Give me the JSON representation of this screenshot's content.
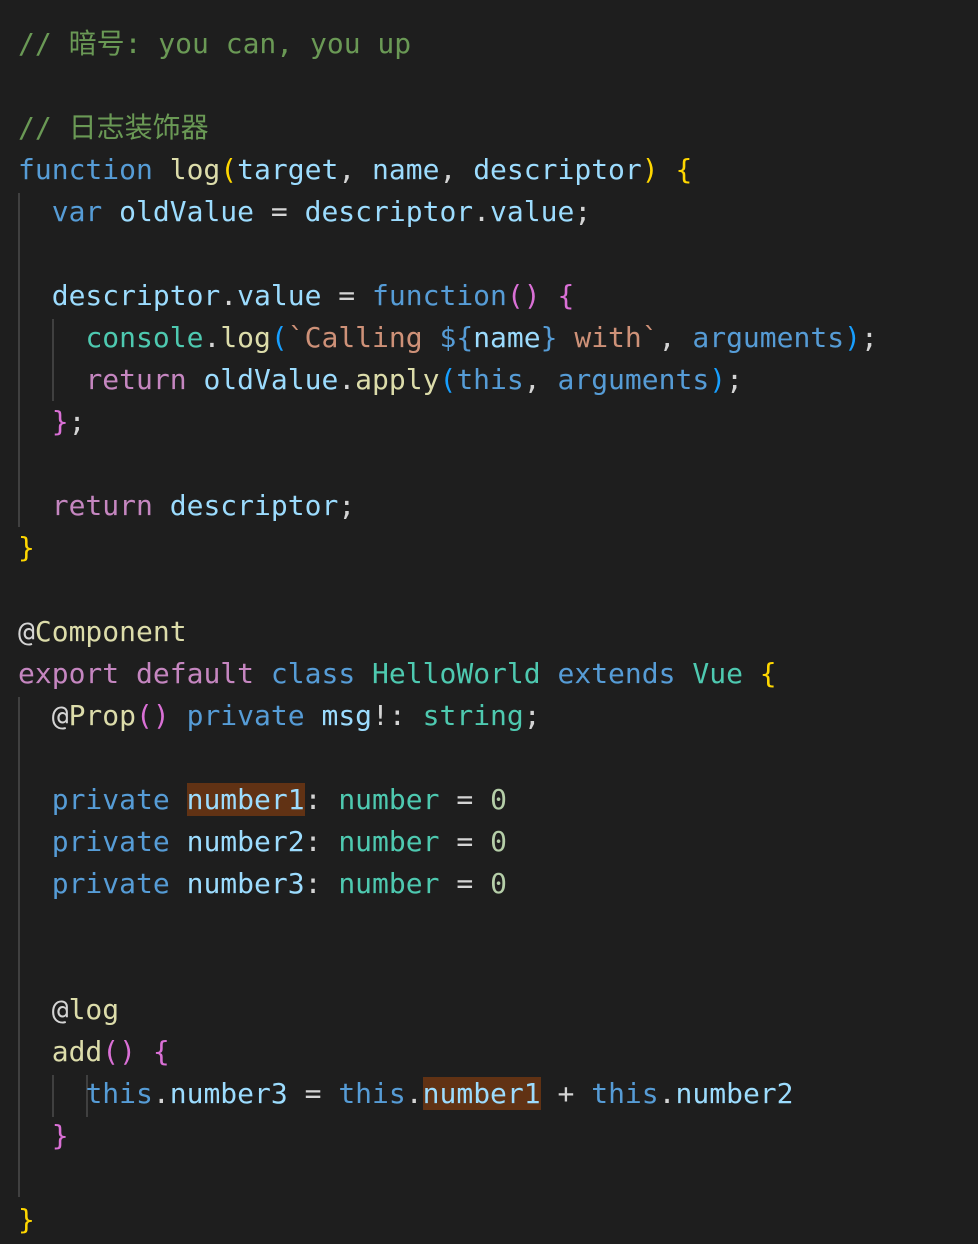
{
  "colors": {
    "background": "#1e1e1e",
    "comment": "#6a9955",
    "keyword_blue": "#569cd6",
    "keyword_purple": "#c586c0",
    "function": "#dcdcaa",
    "variable": "#9cdcfe",
    "type": "#4ec9b0",
    "string": "#ce9178",
    "number": "#b5cea8",
    "plain": "#d4d4d4",
    "bracket_gold": "#ffd700",
    "bracket_pink": "#da70d6",
    "bracket_blue": "#179fff",
    "highlight_bg": "#613214",
    "indent_guide": "#404040"
  },
  "code_lines": [
    [
      {
        "t": "// 暗号: you can, you up",
        "c": "comment"
      }
    ],
    [],
    [
      {
        "t": "// 日志装饰器",
        "c": "comment"
      }
    ],
    [
      {
        "t": "function",
        "c": "keyword_blue"
      },
      {
        "t": " ",
        "c": "plain"
      },
      {
        "t": "log",
        "c": "function"
      },
      {
        "t": "(",
        "c": "bracket_gold"
      },
      {
        "t": "target",
        "c": "variable"
      },
      {
        "t": ", ",
        "c": "plain"
      },
      {
        "t": "name",
        "c": "variable"
      },
      {
        "t": ", ",
        "c": "plain"
      },
      {
        "t": "descriptor",
        "c": "variable"
      },
      {
        "t": ")",
        "c": "bracket_gold"
      },
      {
        "t": " ",
        "c": "plain"
      },
      {
        "t": "{",
        "c": "bracket_gold"
      }
    ],
    [
      {
        "t": "  ",
        "c": "plain"
      },
      {
        "t": "var",
        "c": "keyword_blue"
      },
      {
        "t": " ",
        "c": "plain"
      },
      {
        "t": "oldValue",
        "c": "variable"
      },
      {
        "t": " = ",
        "c": "plain"
      },
      {
        "t": "descriptor",
        "c": "variable"
      },
      {
        "t": ".",
        "c": "plain"
      },
      {
        "t": "value",
        "c": "variable"
      },
      {
        "t": ";",
        "c": "plain"
      }
    ],
    [],
    [
      {
        "t": "  ",
        "c": "plain"
      },
      {
        "t": "descriptor",
        "c": "variable"
      },
      {
        "t": ".",
        "c": "plain"
      },
      {
        "t": "value",
        "c": "variable"
      },
      {
        "t": " = ",
        "c": "plain"
      },
      {
        "t": "function",
        "c": "keyword_blue"
      },
      {
        "t": "()",
        "c": "bracket_pink"
      },
      {
        "t": " ",
        "c": "plain"
      },
      {
        "t": "{",
        "c": "bracket_pink"
      }
    ],
    [
      {
        "t": "    ",
        "c": "plain"
      },
      {
        "t": "console",
        "c": "type"
      },
      {
        "t": ".",
        "c": "plain"
      },
      {
        "t": "log",
        "c": "function"
      },
      {
        "t": "(",
        "c": "bracket_blue"
      },
      {
        "t": "`Calling ",
        "c": "string"
      },
      {
        "t": "${",
        "c": "keyword_blue"
      },
      {
        "t": "name",
        "c": "variable"
      },
      {
        "t": "}",
        "c": "keyword_blue"
      },
      {
        "t": " with`",
        "c": "string"
      },
      {
        "t": ", ",
        "c": "plain"
      },
      {
        "t": "arguments",
        "c": "keyword_blue"
      },
      {
        "t": ")",
        "c": "bracket_blue"
      },
      {
        "t": ";",
        "c": "plain"
      }
    ],
    [
      {
        "t": "    ",
        "c": "plain"
      },
      {
        "t": "return",
        "c": "keyword_purple"
      },
      {
        "t": " ",
        "c": "plain"
      },
      {
        "t": "oldValue",
        "c": "variable"
      },
      {
        "t": ".",
        "c": "plain"
      },
      {
        "t": "apply",
        "c": "function"
      },
      {
        "t": "(",
        "c": "bracket_blue"
      },
      {
        "t": "this",
        "c": "keyword_blue"
      },
      {
        "t": ", ",
        "c": "plain"
      },
      {
        "t": "arguments",
        "c": "keyword_blue"
      },
      {
        "t": ")",
        "c": "bracket_blue"
      },
      {
        "t": ";",
        "c": "plain"
      }
    ],
    [
      {
        "t": "  ",
        "c": "plain"
      },
      {
        "t": "}",
        "c": "bracket_pink"
      },
      {
        "t": ";",
        "c": "plain"
      }
    ],
    [],
    [
      {
        "t": "  ",
        "c": "plain"
      },
      {
        "t": "return",
        "c": "keyword_purple"
      },
      {
        "t": " ",
        "c": "plain"
      },
      {
        "t": "descriptor",
        "c": "variable"
      },
      {
        "t": ";",
        "c": "plain"
      }
    ],
    [
      {
        "t": "}",
        "c": "bracket_gold"
      }
    ],
    [],
    [
      {
        "t": "@",
        "c": "plain"
      },
      {
        "t": "Component",
        "c": "function"
      }
    ],
    [
      {
        "t": "export",
        "c": "keyword_purple"
      },
      {
        "t": " ",
        "c": "plain"
      },
      {
        "t": "default",
        "c": "keyword_purple"
      },
      {
        "t": " ",
        "c": "plain"
      },
      {
        "t": "class",
        "c": "keyword_blue"
      },
      {
        "t": " ",
        "c": "plain"
      },
      {
        "t": "HelloWorld",
        "c": "type"
      },
      {
        "t": " ",
        "c": "plain"
      },
      {
        "t": "extends",
        "c": "keyword_blue"
      },
      {
        "t": " ",
        "c": "plain"
      },
      {
        "t": "Vue",
        "c": "type"
      },
      {
        "t": " ",
        "c": "plain"
      },
      {
        "t": "{",
        "c": "bracket_gold"
      }
    ],
    [
      {
        "t": "  ",
        "c": "plain"
      },
      {
        "t": "@",
        "c": "plain"
      },
      {
        "t": "Prop",
        "c": "function"
      },
      {
        "t": "()",
        "c": "bracket_pink"
      },
      {
        "t": " ",
        "c": "plain"
      },
      {
        "t": "private",
        "c": "keyword_blue"
      },
      {
        "t": " ",
        "c": "plain"
      },
      {
        "t": "msg",
        "c": "variable"
      },
      {
        "t": "!: ",
        "c": "plain"
      },
      {
        "t": "string",
        "c": "type"
      },
      {
        "t": ";",
        "c": "plain"
      }
    ],
    [],
    [
      {
        "t": "  ",
        "c": "plain"
      },
      {
        "t": "private",
        "c": "keyword_blue"
      },
      {
        "t": " ",
        "c": "plain"
      },
      {
        "t": "number1",
        "c": "variable",
        "hl": true
      },
      {
        "t": ": ",
        "c": "plain"
      },
      {
        "t": "number",
        "c": "type"
      },
      {
        "t": " = ",
        "c": "plain"
      },
      {
        "t": "0",
        "c": "number"
      }
    ],
    [
      {
        "t": "  ",
        "c": "plain"
      },
      {
        "t": "private",
        "c": "keyword_blue"
      },
      {
        "t": " ",
        "c": "plain"
      },
      {
        "t": "number2",
        "c": "variable"
      },
      {
        "t": ": ",
        "c": "plain"
      },
      {
        "t": "number",
        "c": "type"
      },
      {
        "t": " = ",
        "c": "plain"
      },
      {
        "t": "0",
        "c": "number"
      }
    ],
    [
      {
        "t": "  ",
        "c": "plain"
      },
      {
        "t": "private",
        "c": "keyword_blue"
      },
      {
        "t": " ",
        "c": "plain"
      },
      {
        "t": "number3",
        "c": "variable"
      },
      {
        "t": ": ",
        "c": "plain"
      },
      {
        "t": "number",
        "c": "type"
      },
      {
        "t": " = ",
        "c": "plain"
      },
      {
        "t": "0",
        "c": "number"
      }
    ],
    [],
    [],
    [
      {
        "t": "  ",
        "c": "plain"
      },
      {
        "t": "@",
        "c": "plain"
      },
      {
        "t": "log",
        "c": "function"
      }
    ],
    [
      {
        "t": "  ",
        "c": "plain"
      },
      {
        "t": "add",
        "c": "function"
      },
      {
        "t": "()",
        "c": "bracket_pink"
      },
      {
        "t": " ",
        "c": "plain"
      },
      {
        "t": "{",
        "c": "bracket_pink"
      }
    ],
    [
      {
        "t": "    ",
        "c": "plain"
      },
      {
        "t": "this",
        "c": "keyword_blue"
      },
      {
        "t": ".",
        "c": "plain"
      },
      {
        "t": "number3",
        "c": "variable"
      },
      {
        "t": " = ",
        "c": "plain"
      },
      {
        "t": "this",
        "c": "keyword_blue"
      },
      {
        "t": ".",
        "c": "plain"
      },
      {
        "t": "number1",
        "c": "variable",
        "hl": true
      },
      {
        "t": " + ",
        "c": "plain"
      },
      {
        "t": "this",
        "c": "keyword_blue"
      },
      {
        "t": ".",
        "c": "plain"
      },
      {
        "t": "number2",
        "c": "variable"
      }
    ],
    [
      {
        "t": "  ",
        "c": "plain"
      },
      {
        "t": "}",
        "c": "bracket_pink"
      }
    ],
    [],
    [
      {
        "t": "}",
        "c": "bracket_gold"
      }
    ]
  ]
}
